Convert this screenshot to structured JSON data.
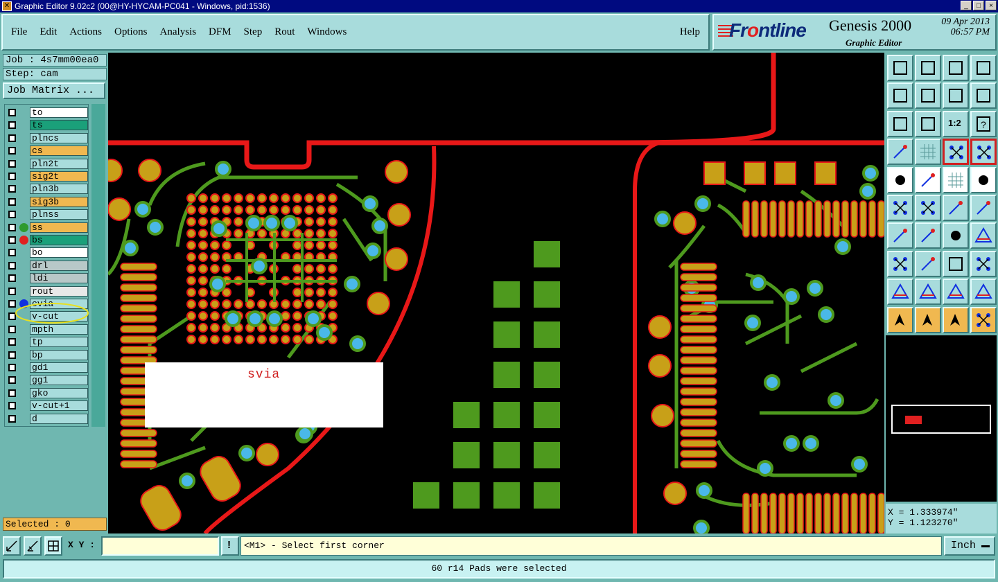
{
  "window": {
    "title": "Graphic Editor 9.02c2 (00@HY-HYCAM-PC041 - Windows, pid:1536)",
    "controls": [
      "_",
      "□",
      "×"
    ]
  },
  "menu": {
    "items": [
      "File",
      "Edit",
      "Actions",
      "Options",
      "Analysis",
      "DFM",
      "Step",
      "Rout",
      "Windows"
    ],
    "help": "Help"
  },
  "brand": {
    "logo_pre": "Fr",
    "logo_o": "o",
    "logo_post": "ntline",
    "product": "Genesis 2000",
    "subtitle": "Graphic Editor",
    "date": "09 Apr 2013",
    "time": "06:57 PM"
  },
  "job": {
    "job_label": "Job : 4s7mm00ea0",
    "step_label": "Step: cam",
    "matrix_button": "Job Matrix ..."
  },
  "layers": [
    {
      "name": "to",
      "color": "#ffffff",
      "flag": "⬖"
    },
    {
      "name": "ts",
      "color": "#1aa07a",
      "flag": ""
    },
    {
      "name": "plncs",
      "color": "#a8dcdc",
      "flag": ""
    },
    {
      "name": "cs",
      "color": "#f0b850",
      "flag": ""
    },
    {
      "name": "pln2t",
      "color": "#a8dcdc",
      "flag": ""
    },
    {
      "name": "sig2t",
      "color": "#f0b850",
      "flag": "⬖"
    },
    {
      "name": "pln3b",
      "color": "#a8dcdc",
      "flag": ""
    },
    {
      "name": "sig3b",
      "color": "#f0b850",
      "flag": ""
    },
    {
      "name": "plnss",
      "color": "#a8dcdc",
      "flag": ""
    },
    {
      "name": "ss",
      "color": "#f0b850",
      "flag": "",
      "dot": "#2f9a2f"
    },
    {
      "name": "bs",
      "color": "#1aa07a",
      "flag": "⊞",
      "dot": "#e02020"
    },
    {
      "name": "bo",
      "color": "#ffffff",
      "flag": "⬖"
    },
    {
      "name": "drl",
      "color": "#b8c8c8",
      "flag": ""
    },
    {
      "name": "ldi",
      "color": "#b8c8c8",
      "flag": ""
    },
    {
      "name": "rout",
      "color": "#e8e8e8",
      "flag": ""
    },
    {
      "name": "cvia",
      "color": "#a8dcdc",
      "flag": "",
      "dot": "#1030e0"
    },
    {
      "name": "v-cut",
      "color": "#a8dcdc",
      "flag": ""
    },
    {
      "name": "mpth",
      "color": "#a8dcdc",
      "flag": ""
    },
    {
      "name": "tp",
      "color": "#a8dcdc",
      "flag": ""
    },
    {
      "name": "bp",
      "color": "#a8dcdc",
      "flag": ""
    },
    {
      "name": "gd1",
      "color": "#a8dcdc",
      "flag": "⬖"
    },
    {
      "name": "gg1",
      "color": "#a8dcdc",
      "flag": ""
    },
    {
      "name": "gko",
      "color": "#a8dcdc",
      "flag": "⬖"
    },
    {
      "name": "v-cut+1",
      "color": "#a8dcdc",
      "flag": ""
    },
    {
      "name": "d",
      "color": "#a8dcdc",
      "flag": ""
    }
  ],
  "selection": {
    "label": "Selected : 0"
  },
  "canvas": {
    "annotation": "svia"
  },
  "tools": [
    "import-icon",
    "zoom-home-icon",
    "home-icon",
    "window-icon",
    "zoom-in-icon",
    "zoom-out-icon",
    "pan-icon",
    "redraw-icon",
    "fit-icon",
    "center-icon",
    "ratio-icon",
    "help-icon",
    "settings-icon",
    "grid-icon",
    "layers-icon",
    "compare-icon",
    "select-icon",
    "polygon-icon",
    "ruler-icon",
    "dotted-icon",
    "node-icon",
    "cross-icon",
    "line-add-icon",
    "line-move-icon",
    "angle-icon",
    "slash-icon",
    "rotate-icon",
    "split-icon",
    "point-icon",
    "red-line-icon",
    "box-icon",
    "pads-icon",
    "triangle-icon",
    "triangle-blue-icon",
    "arch-icon",
    "arch-red-icon",
    "pointer-icon",
    "pointer-box-icon",
    "pointer-red-icon",
    "connect-icon"
  ],
  "tool_ratio_label": "1:2",
  "coords": {
    "x": "X = 1.333974\"",
    "y": "Y = 1.123270\""
  },
  "bottom": {
    "xy_label": "X Y :",
    "xy_value": "",
    "prompt": "<M1> - Select first corner",
    "units": "Inch",
    "warn": "!"
  },
  "status": "60 r14 Pads were selected"
}
